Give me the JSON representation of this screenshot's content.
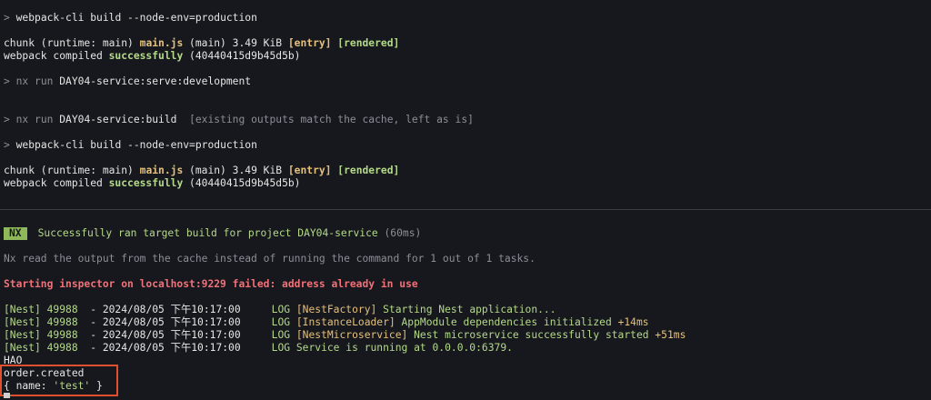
{
  "lines": {
    "l1": {
      "prompt": ">",
      "cmd": "webpack-cli build --node-env=production"
    },
    "l2": {
      "a": "chunk (runtime: main) ",
      "file": "main.js",
      "b": " (main) 3.49 KiB ",
      "entry": "[entry]",
      "sp": " ",
      "rendered": "[rendered]"
    },
    "l3": {
      "a": "webpack compiled ",
      "status": "successfully",
      "b": " (40440415d9b45d5b)"
    },
    "l4": {
      "prompt": ">",
      "nx": " nx run ",
      "target": "DAY04-service:serve:development"
    },
    "l5": {
      "prompt": ">",
      "nx": " nx run ",
      "target": "DAY04-service:build",
      "note": "  [existing outputs match the cache, left as is]"
    },
    "l6": {
      "prompt": ">",
      "cmd": "webpack-cli build --node-env=production"
    },
    "l7": {
      "a": "chunk (runtime: main) ",
      "file": "main.js",
      "b": " (main) 3.49 KiB ",
      "entry": "[entry]",
      "sp": " ",
      "rendered": "[rendered]"
    },
    "l8": {
      "a": "webpack compiled ",
      "status": "successfully",
      "b": " (40440415d9b45d5b)"
    },
    "nx": {
      "badge": "NX",
      "msg": "Successfully ran target build for project DAY04-service",
      "time": " (60ms)"
    },
    "cache": "Nx read the output from the cache instead of running the command for 1 out of 1 tasks.",
    "inspector": "Starting inspector on localhost:9229 failed: address already in use",
    "logs": [
      {
        "prefix": "[Nest] 49988",
        "mid": "  - 2024/08/05 下午10:17:00     ",
        "level": "LOG ",
        "ctx": "[NestFactory]",
        "msg": " Starting Nest application...",
        "dur": ""
      },
      {
        "prefix": "[Nest] 49988",
        "mid": "  - 2024/08/05 下午10:17:00     ",
        "level": "LOG ",
        "ctx": "[InstanceLoader]",
        "msg": " AppModule dependencies initialized ",
        "dur": "+14ms"
      },
      {
        "prefix": "[Nest] 49988",
        "mid": "  - 2024/08/05 下午10:17:00     ",
        "level": "LOG ",
        "ctx": "[NestMicroservice]",
        "msg": " Nest microservice successfully started ",
        "dur": "+51ms"
      },
      {
        "prefix": "[Nest] 49988",
        "mid": "  - 2024/08/05 下午10:17:00     ",
        "level": "LOG ",
        "ctx": "",
        "msg": "Service is running at 0.0.0.0:6379.",
        "dur": ""
      }
    ],
    "hao": "HAO",
    "event": "order.created",
    "obj_open": "{ name: ",
    "obj_val": "'test'",
    "obj_close": " }"
  }
}
